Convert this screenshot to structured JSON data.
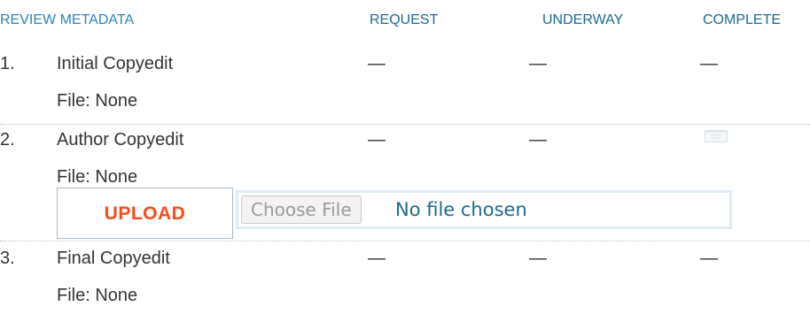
{
  "header": {
    "review_metadata": "REVIEW METADATA",
    "request": "REQUEST",
    "underway": "UNDERWAY",
    "complete": "COMPLETE"
  },
  "rows": [
    {
      "number": "1.",
      "title": "Initial Copyedit",
      "file": "File: None",
      "request": "—",
      "underway": "—",
      "complete": "—"
    },
    {
      "number": "2.",
      "title": "Author Copyedit",
      "file": "File: None",
      "request": "—",
      "underway": "—",
      "complete_icon": "email-icon"
    },
    {
      "number": "3.",
      "title": "Final Copyedit",
      "file": "File: None",
      "request": "—",
      "underway": "—",
      "complete": "—"
    }
  ],
  "upload": {
    "button_label": "UPLOAD",
    "choose_file_label": "Choose File",
    "no_file_text": "No file chosen"
  },
  "colors": {
    "header_link": "#2a84b3",
    "header_text": "#1a6a8e",
    "upload_accent": "#ff4a18",
    "file_area_border": "#dcecf4"
  }
}
